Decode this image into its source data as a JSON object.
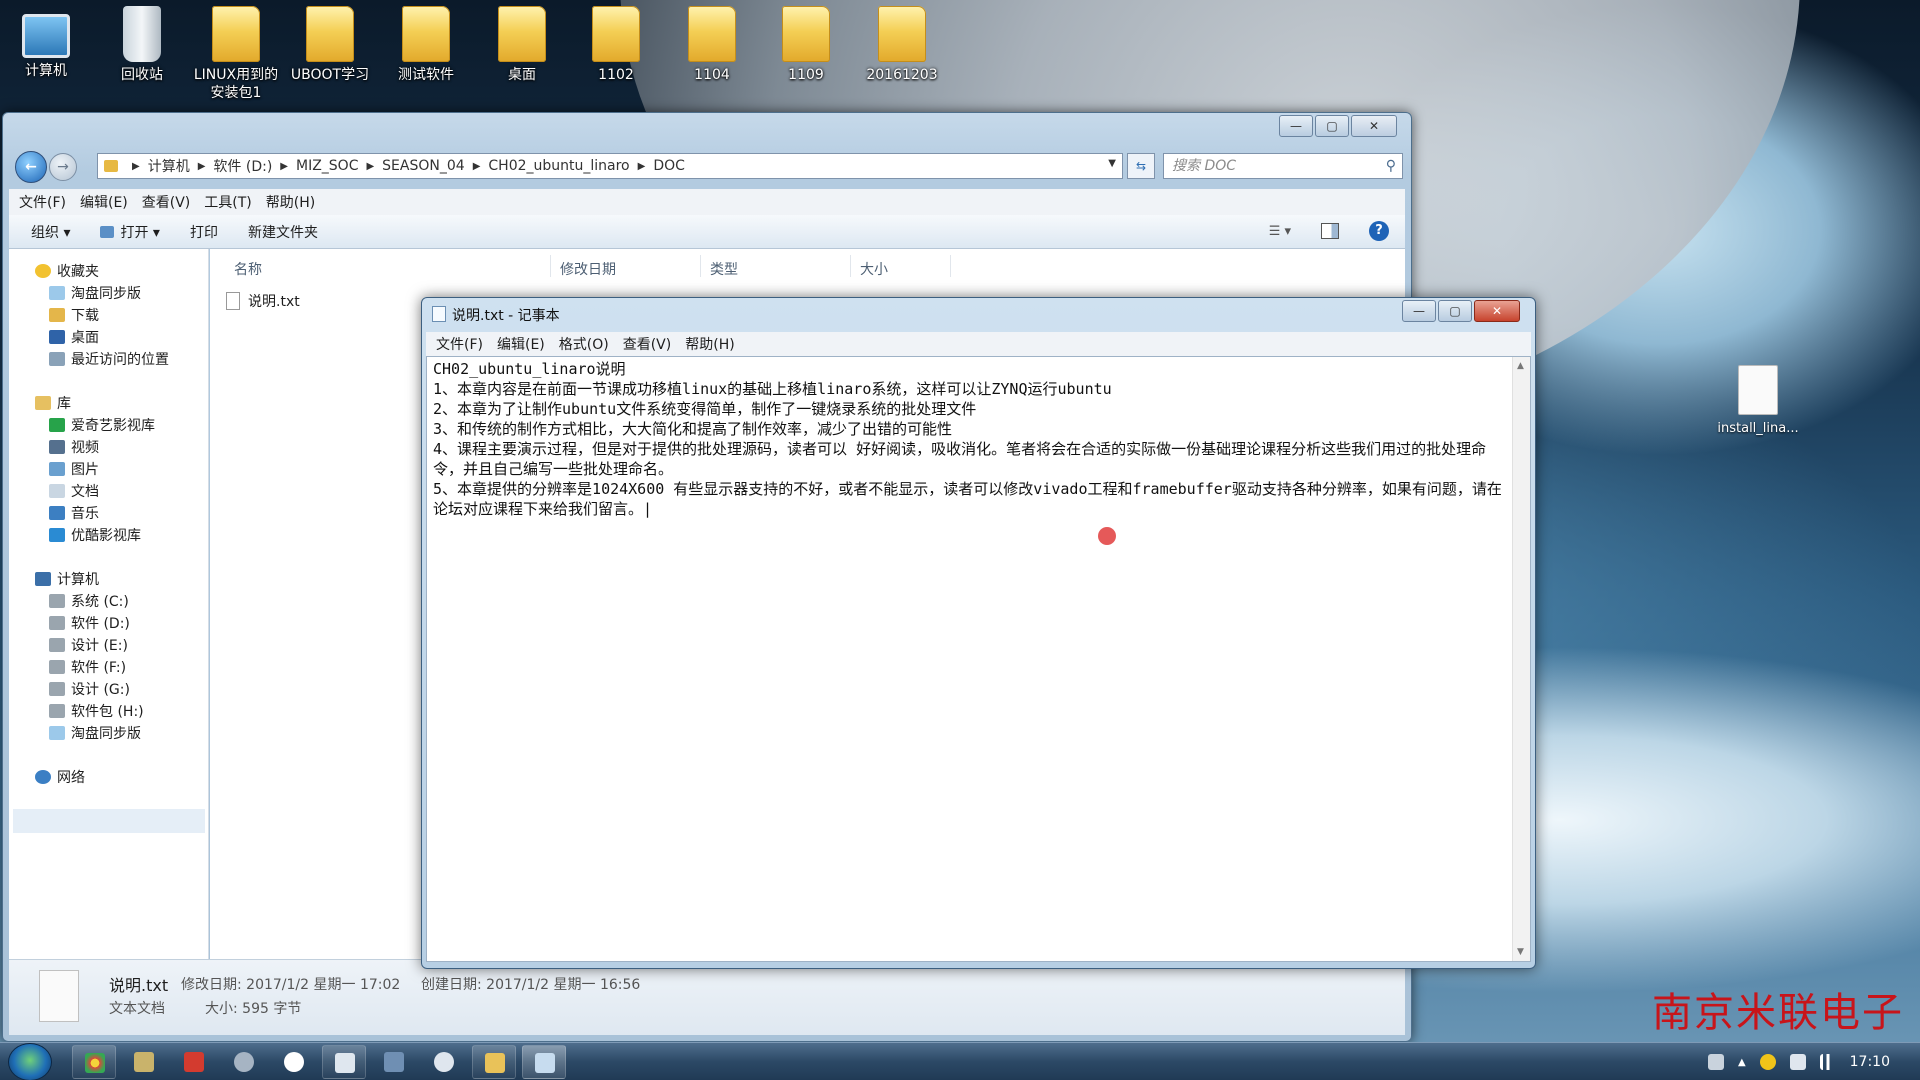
{
  "desktop": {
    "icons": [
      {
        "label": "计算机"
      },
      {
        "label": "回收站"
      },
      {
        "label": "LINUX用到的安装包1"
      },
      {
        "label": "UBOOT学习"
      },
      {
        "label": "测试软件"
      },
      {
        "label": "桌面"
      },
      {
        "label": "1102"
      },
      {
        "label": "1104"
      },
      {
        "label": "1109"
      },
      {
        "label": "20161203"
      }
    ],
    "right_file": "install_lina..."
  },
  "explorer": {
    "address": [
      "计算机",
      "软件 (D:)",
      "MIZ_SOC",
      "SEASON_04",
      "CH02_ubuntu_linaro",
      "DOC"
    ],
    "search_placeholder": "搜索 DOC",
    "menu": [
      "文件(F)",
      "编辑(E)",
      "查看(V)",
      "工具(T)",
      "帮助(H)"
    ],
    "toolbar": {
      "organize": "组织 ▾",
      "open": "打开 ▾",
      "print": "打印",
      "new_folder": "新建文件夹"
    },
    "nav": {
      "favorites": "收藏夹",
      "fav_items": [
        "淘盘同步版",
        "下载",
        "桌面",
        "最近访问的位置"
      ],
      "libraries": "库",
      "lib_items": [
        "爱奇艺影视库",
        "视频",
        "图片",
        "文档",
        "音乐",
        "优酷影视库"
      ],
      "computer": "计算机",
      "drives": [
        "系统 (C:)",
        "软件 (D:)",
        "设计 (E:)",
        "软件 (F:)",
        "设计 (G:)",
        "软件包 (H:)",
        "淘盘同步版"
      ],
      "network": "网络"
    },
    "columns": [
      "名称",
      "修改日期",
      "类型",
      "大小"
    ],
    "files": [
      {
        "name": "说明.txt"
      }
    ],
    "details": {
      "filename": "说明.txt",
      "modified": "修改日期: 2017/1/2 星期一 17:02",
      "created": "创建日期: 2017/1/2 星期一 16:56",
      "type": "文本文档",
      "size": "大小: 595 字节"
    }
  },
  "notepad": {
    "title": "说明.txt - 记事本",
    "menu": [
      "文件(F)",
      "编辑(E)",
      "格式(O)",
      "查看(V)",
      "帮助(H)"
    ],
    "text": "CH02_ubuntu_linaro说明\n1、本章内容是在前面一节课成功移植linux的基础上移植linaro系统，这样可以让ZYNQ运行ubuntu\n2、本章为了让制作ubuntu文件系统变得简单，制作了一键烧录系统的批处理文件\n3、和传统的制作方式相比，大大简化和提高了制作效率，减少了出错的可能性\n4、课程主要演示过程，但是对于提供的批处理源码，读者可以 好好阅读，吸收消化。笔者将会在合适的实际做一份基础理论课程分析这些我们用过的批处理命令，并且自己编写一些批处理命名。\n5、本章提供的分辨率是1024X600 有些显示器支持的不好，或者不能显示，读者可以修改vivado工程和framebuffer驱动支持各种分辨率，如果有问题，请在论坛对应课程下来给我们留言。|"
  },
  "watermark": "南京米联电子",
  "taskbar": {
    "clock": "17:10"
  }
}
